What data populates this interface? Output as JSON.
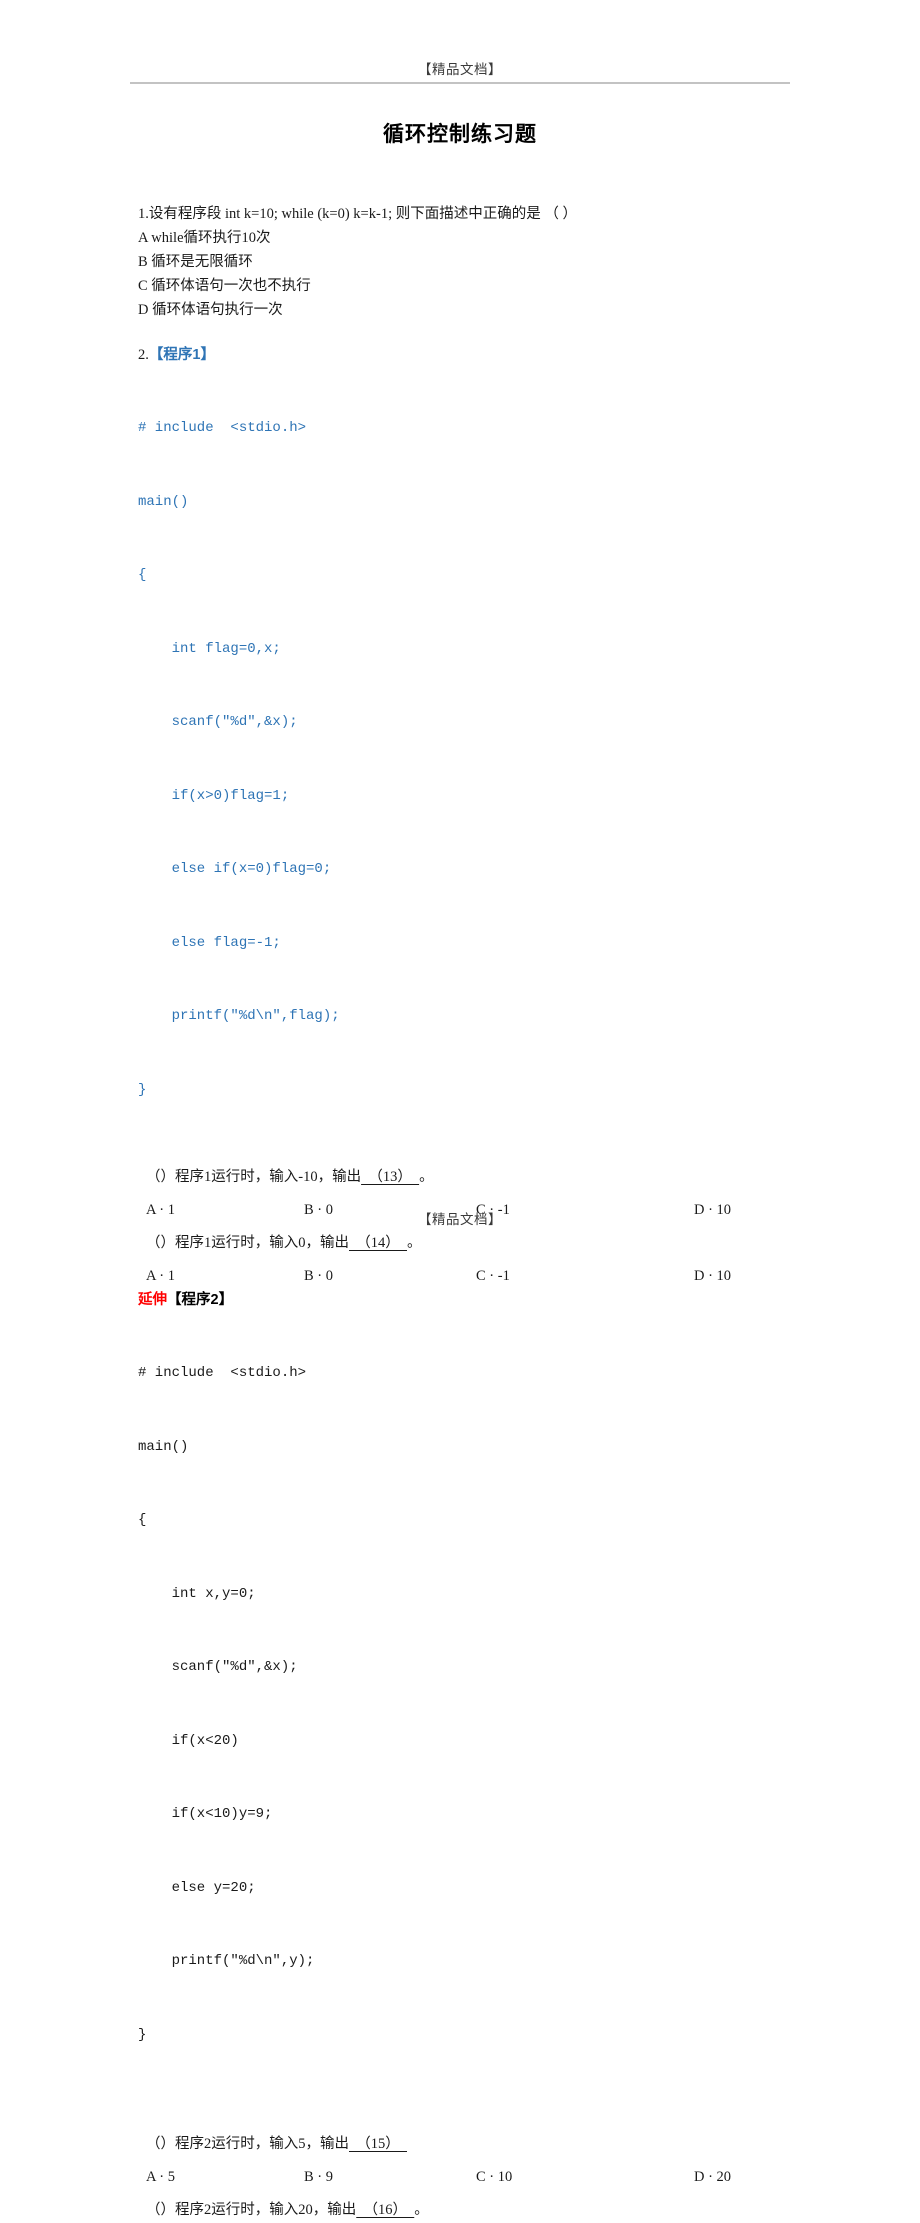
{
  "header": {
    "watermark": "【精品文档】"
  },
  "title": "循环控制练习题",
  "question1": {
    "stem": "1.设有程序段 int k=10; while (k=0) k=k-1; 则下面描述中正确的是 （ ）",
    "options": [
      "A while循环执行10次",
      "B 循环是无限循环",
      "C 循环体语句一次也不执行",
      "D 循环体语句执行一次"
    ]
  },
  "program1": {
    "number": "2.",
    "label": "【程序1】",
    "code": [
      "# include  <stdio.h>",
      "main()",
      "{",
      "    int flag=0,x;",
      "    scanf(\"%d\",&x);",
      "    if(x>0)flag=1;",
      "    else if(x=0)flag=0;",
      "    else flag=-1;",
      "    printf(\"%d\\n\",flag);",
      "}"
    ],
    "questions": [
      {
        "prefix": "（）程序1运行时，输入-10，输出",
        "blank": "  （13）  ",
        "suffix": "。",
        "choices": [
          "A · 1",
          "B · 0",
          "C · -1",
          "D · 10"
        ]
      },
      {
        "prefix": "（）程序1运行时，输入0，输出",
        "blank": "  （14）  ",
        "suffix": "。",
        "choices": [
          "A · 1",
          "B · 0",
          "C · -1",
          "D · 10"
        ]
      }
    ]
  },
  "program2": {
    "extend_label": "延伸",
    "label": "【程序2】",
    "code": [
      "# include  <stdio.h>",
      "main()",
      "{",
      "    int x,y=0;",
      "    scanf(\"%d\",&x);",
      "    if(x<20)",
      "    if(x<10)y=9;",
      "    else y=20;",
      "    printf(\"%d\\n\",y);",
      "}"
    ],
    "questions": [
      {
        "prefix": "（）程序2运行时，输入5，输出",
        "blank": "  （15）  ",
        "suffix": "",
        "choices": [
          "A · 5",
          "B · 9",
          "C · 10",
          "D · 20"
        ]
      },
      {
        "prefix": "（）程序2运行时，输入20，输出",
        "blank": "  （16）  ",
        "suffix": "。",
        "choices": []
      }
    ]
  },
  "footer": {
    "watermark": "【精品文档】"
  },
  "colors": {
    "code_blue": "#2e74b5",
    "extend_red": "#ff0000",
    "rule_gray": "#c3c3c3"
  }
}
